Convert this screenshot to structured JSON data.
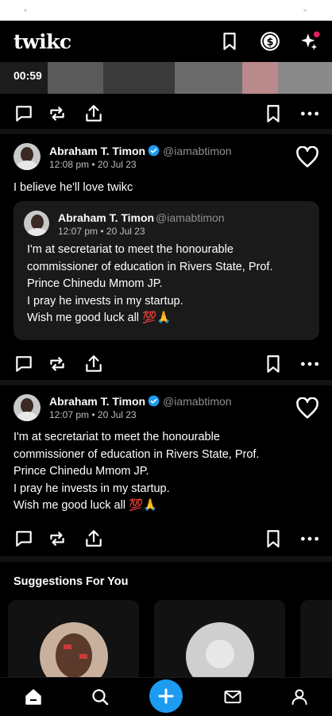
{
  "app": {
    "title": "twikc"
  },
  "media": {
    "time": "00:59"
  },
  "post1": {
    "author": "Abraham T. Timon",
    "handle": "@iamabtimon",
    "meta": "12:08 pm • 20 Jul 23",
    "text": "I believe he'll love twikc",
    "quote": {
      "author": "Abraham T. Timon",
      "handle": "@iamabtimon",
      "meta": "12:07 pm • 20 Jul 23",
      "text": "I'm at secretariat to meet the honourable\ncommissioner of education in Rivers State,  Prof.\nPrince Chinedu Mmom JP.\nI pray he invests in my startup.\nWish me good luck all 💯🙏"
    }
  },
  "post2": {
    "author": "Abraham T. Timon",
    "handle": "@iamabtimon",
    "meta": "12:07 pm • 20 Jul 23",
    "text": "I'm at secretariat to meet the honourable\ncommissioner of education in Rivers State,  Prof.\nPrince Chinedu Mmom JP.\nI pray he invests in my startup.\nWish me good luck all 💯🙏"
  },
  "suggestions": {
    "title": "Suggestions For You"
  },
  "icons": {
    "top": [
      "bookmark-icon",
      "coin-icon",
      "sparkle-icon"
    ],
    "actions": [
      "comment-icon",
      "repost-icon",
      "share-icon",
      "bookmark-icon",
      "more-icon"
    ],
    "nav": [
      "home-icon",
      "search-icon",
      "add-icon",
      "mail-icon",
      "profile-icon"
    ]
  },
  "colors": {
    "accent": "#1d9bf0",
    "notification": "#e0245e",
    "background": "#000000"
  }
}
